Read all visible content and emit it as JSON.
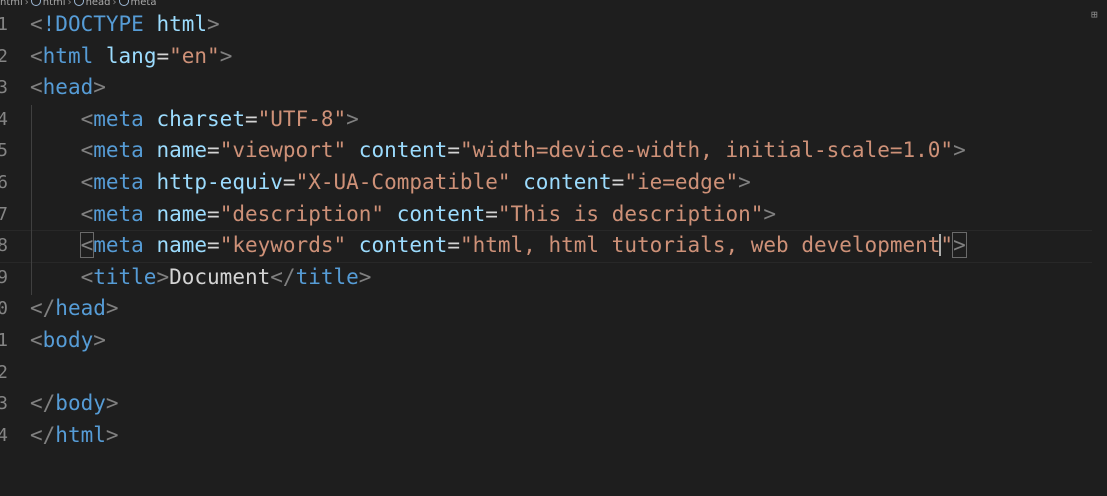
{
  "breadcrumb": {
    "items": [
      "html",
      "html",
      "head",
      "meta"
    ]
  },
  "editor": {
    "line_numbers": [
      "1",
      "2",
      "3",
      "4",
      "5",
      "6",
      "7",
      "8",
      "9",
      "0",
      "1",
      "2",
      "3",
      "4"
    ],
    "code": {
      "l1_doctype": "!DOCTYPE",
      "l1_html": "html",
      "l2_tag": "html",
      "l2_attr": "lang",
      "l2_val": "\"en\"",
      "l3_tag": "head",
      "l4_tag": "meta",
      "l4_attr": "charset",
      "l4_val": "\"UTF-8\"",
      "l5_tag": "meta",
      "l5_attr1": "name",
      "l5_val1": "\"viewport\"",
      "l5_attr2": "content",
      "l5_val2": "\"width=device-width, initial-scale=1.0\"",
      "l6_tag": "meta",
      "l6_attr1": "http-equiv",
      "l6_val1": "\"X-UA-Compatible\"",
      "l6_attr2": "content",
      "l6_val2": "\"ie=edge\"",
      "l7_tag": "meta",
      "l7_attr1": "name",
      "l7_val1": "\"description\"",
      "l7_attr2": "content",
      "l7_val2": "\"This is description\"",
      "l8_tag": "meta",
      "l8_attr1": "name",
      "l8_val1": "\"keywords\"",
      "l8_attr2": "content",
      "l8_val2a": "\"html, html tutorials, web development",
      "l8_val2b": "\"",
      "l9_tag_open": "title",
      "l9_text": "Document",
      "l9_tag_close": "title",
      "l10_tag": "head",
      "l11_tag": "body",
      "l13_tag": "body",
      "l14_tag": "html"
    }
  },
  "colors": {
    "background": "#1e1e1e",
    "punctuation": "#808080",
    "tag": "#569cd6",
    "attribute": "#9cdcfe",
    "string": "#ce9178",
    "text": "#d4d4d4"
  }
}
